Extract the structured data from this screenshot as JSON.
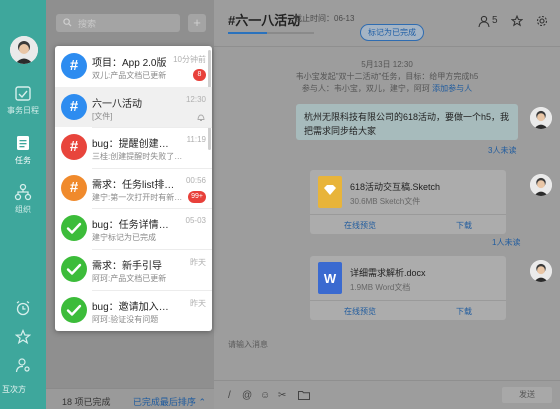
{
  "colors": {
    "rail": "#3ea79c",
    "accent": "#2a72bd",
    "blue_circle": "#2d8cf0",
    "red_circle": "#e8453c",
    "orange_circle": "#f08a2c",
    "green_circle": "#3cbc3a",
    "badge": "#e8403a"
  },
  "rail": {
    "items": [
      {
        "label": "事务日程",
        "icon": "calendar-check-icon"
      },
      {
        "label": "任务",
        "icon": "task-list-icon"
      },
      {
        "label": "组织",
        "icon": "org-chart-icon"
      }
    ],
    "bottom_icons": [
      "alarm-clock-icon",
      "star-icon",
      "user-settings-icon"
    ],
    "bottom_label": "互次方"
  },
  "list": {
    "search_placeholder": "搜索",
    "add_label": "+",
    "footer_done": "18 项已完成",
    "footer_sort": "已完成最后排序"
  },
  "conversations": [
    {
      "title": "项目：App 2.0版",
      "sub": "双儿:产品文档已更新",
      "time": "10分钟前",
      "badge": "8",
      "icon": "#",
      "color": "blue"
    },
    {
      "title": "六一八活动",
      "sub": "[文件]",
      "time": "12:30",
      "badge": "",
      "icon": "#",
      "color": "blue",
      "muted": true
    },
    {
      "title": "bug：提醒创建不了",
      "sub": "三桂:创建提醒时失败了…",
      "time": "11:19",
      "badge": "",
      "icon": "#",
      "color": "red"
    },
    {
      "title": "需求：任务list排序…",
      "sub": "建宁:第一次打开时有新…",
      "time": "00:56",
      "badge": "99+",
      "icon": "#",
      "color": "orange"
    },
    {
      "title": "bug：任务详情没有…",
      "sub": "建宁标记为已完成",
      "time": "05-03",
      "badge": "",
      "icon": "check",
      "color": "green"
    },
    {
      "title": "需求：新手引导",
      "sub": "阿珂:产品文档已更新",
      "time": "昨天",
      "badge": "",
      "icon": "check",
      "color": "green"
    },
    {
      "title": "bug：邀请加入撤销…",
      "sub": "阿珂:验证没有问题",
      "time": "昨天",
      "badge": "",
      "icon": "check",
      "color": "green"
    }
  ],
  "chat": {
    "title": "#六一八活动",
    "deadline": "截止时间：06-13",
    "members_count": "5",
    "mark_done": "标记为已完成",
    "progress_fraction": 0.45,
    "sys_date": "5月13日 12:30",
    "sys_line1": "韦小宝发起\"双十二活动\"任务，目标：给甲方完成h5",
    "sys_line2": "参与人：韦小宝，双儿，建宁，阿珂",
    "sys_add": "添加参与人",
    "message": "杭州无限科技有限公司的618活动，要做一个h5，我把需求同步给大家",
    "read1": "3人未读",
    "file1": {
      "name": "618活动交互稿.Sketch",
      "meta": "30.6MB  Sketch文件",
      "preview": "在线预览",
      "download": "下载",
      "color": "#e8b43a"
    },
    "read2": "1人未读",
    "file2": {
      "name": "详细需求解析.docx",
      "meta": "1.9MB  Word文档",
      "preview": "在线预览",
      "download": "下载",
      "color": "#3a6ad0"
    },
    "input_placeholder": "请输入消息",
    "send": "发送"
  }
}
